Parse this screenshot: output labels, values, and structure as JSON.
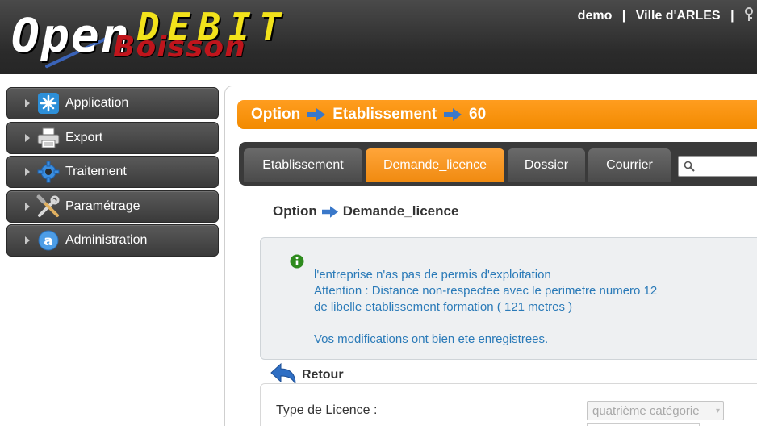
{
  "header": {
    "logo": {
      "open": "Open",
      "debit": "DEBIT",
      "boisson": "Boisson"
    },
    "user": "demo",
    "separator": "|",
    "city": "Ville d'ARLES"
  },
  "sidebar": {
    "items": [
      {
        "label": "Application",
        "icon": "application-star-icon"
      },
      {
        "label": "Export",
        "icon": "printer-icon"
      },
      {
        "label": "Traitement",
        "icon": "gear-icon"
      },
      {
        "label": "Paramétrage",
        "icon": "tools-icon"
      },
      {
        "label": "Administration",
        "icon": "admin-a-icon"
      }
    ]
  },
  "title_bar": {
    "crumbs": [
      "Option",
      "Etablissement",
      "60"
    ]
  },
  "tabs": [
    {
      "label": "Etablissement",
      "active": false
    },
    {
      "label": "Demande_licence",
      "active": true
    },
    {
      "label": "Dossier",
      "active": false
    },
    {
      "label": "Courrier",
      "active": false
    }
  ],
  "search": {
    "placeholder": ""
  },
  "subheading": {
    "crumbs": [
      "Option",
      "Demande_licence"
    ]
  },
  "message": {
    "lines": [
      "l'entreprise n'as pas de permis d'exploitation",
      "Attention : Distance non-respectee avec le perimetre numero 12",
      "de libelle etablissement formation ( 121 metres )",
      "",
      "Vos modifications ont bien ete enregistrees."
    ]
  },
  "retour": {
    "label": "Retour"
  },
  "form": {
    "type_licence_label": "Type de Licence :",
    "type_licence_value": "quatrième catégorie"
  },
  "colors": {
    "accent_orange": "#f28a00",
    "header_dark": "#2b2b2b",
    "message_text": "#2a7ab8",
    "arrow_blue": "#3a78c9"
  }
}
